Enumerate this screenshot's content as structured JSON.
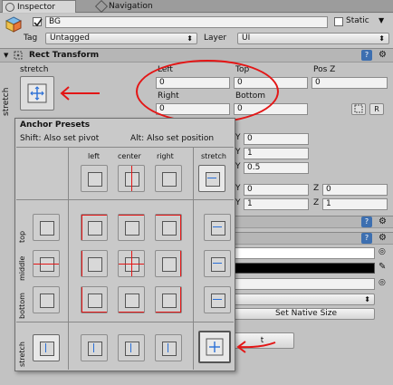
{
  "tabs": {
    "inspector": "Inspector",
    "navigation": "Navigation"
  },
  "object": {
    "name": "BG",
    "static_label": "Static",
    "tag_label": "Tag",
    "tag_value": "Untagged",
    "layer_label": "Layer",
    "layer_value": "UI"
  },
  "rect_transform": {
    "title": "Rect Transform",
    "anchor_h": "stretch",
    "anchor_v": "stretch",
    "left_label": "Left",
    "left_value": "0",
    "top_label": "Top",
    "top_value": "0",
    "posz_label": "Pos Z",
    "posz_value": "0",
    "right_label": "Right",
    "right_value": "0",
    "bottom_label": "Bottom",
    "bottom_value": "0",
    "btn_r": "R"
  },
  "hidden_fields": {
    "y1_label": "Y",
    "y1_value": "0",
    "y2_label": "Y",
    "y2_value": "1",
    "y3_label": "Y",
    "y3_value": "0.5",
    "y4_label": "Y",
    "y4_value": "0",
    "z4_label": "Z",
    "z4_value": "0",
    "y5_label": "Y",
    "y5_value": "1",
    "z5_label": "Z",
    "z5_value": "1"
  },
  "anchor_presets": {
    "title": "Anchor Presets",
    "shift_hint": "Shift: Also set pivot",
    "alt_hint": "Alt: Also set position",
    "columns": [
      "left",
      "center",
      "right",
      "stretch"
    ],
    "rows": [
      "top",
      "middle",
      "bottom",
      "stretch"
    ]
  },
  "image": {
    "set_native_size": "Set Native Size",
    "partial_label": "t"
  },
  "colors": {
    "highlight": "#e31616",
    "selection": "#2a6fd6"
  }
}
